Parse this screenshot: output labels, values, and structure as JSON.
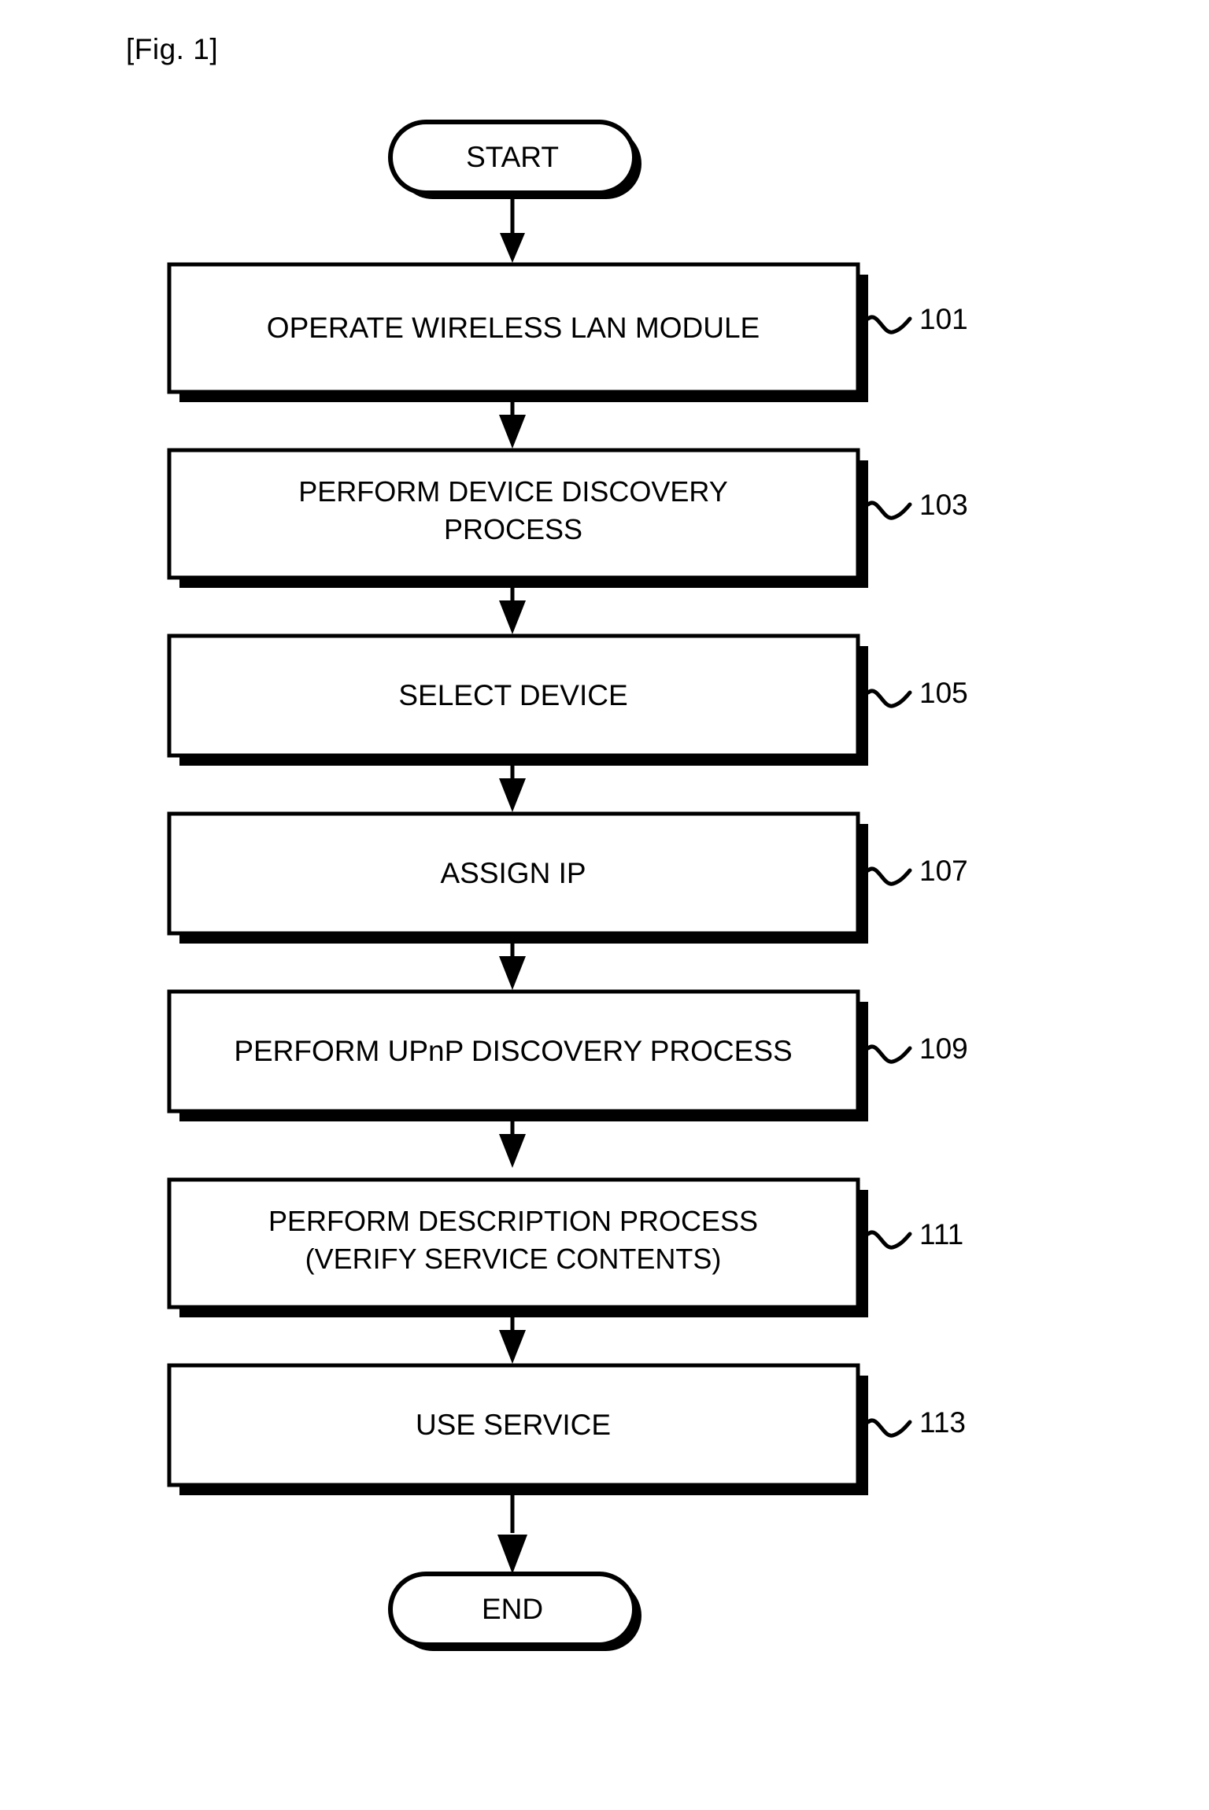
{
  "figure": {
    "label": "[Fig. 1]"
  },
  "diagram": {
    "type": "flowchart",
    "orientation": "vertical",
    "start_node": {
      "label": "START",
      "shape": "stadium"
    },
    "end_node": {
      "label": "END",
      "shape": "stadium"
    },
    "steps": [
      {
        "ref": "101",
        "lines": [
          "OPERATE WIRELESS LAN MODULE"
        ]
      },
      {
        "ref": "103",
        "lines": [
          "PERFORM DEVICE DISCOVERY",
          "PROCESS"
        ]
      },
      {
        "ref": "105",
        "lines": [
          "SELECT DEVICE"
        ]
      },
      {
        "ref": "107",
        "lines": [
          "ASSIGN IP"
        ]
      },
      {
        "ref": "109",
        "lines": [
          "PERFORM UPnP DISCOVERY PROCESS"
        ]
      },
      {
        "ref": "111",
        "lines": [
          "PERFORM DESCRIPTION PROCESS",
          "(VERIFY SERVICE CONTENTS)"
        ]
      },
      {
        "ref": "113",
        "lines": [
          "USE SERVICE"
        ]
      }
    ],
    "colors": {
      "stroke": "#000000",
      "fill": "#ffffff",
      "shadow": "#000000"
    }
  }
}
